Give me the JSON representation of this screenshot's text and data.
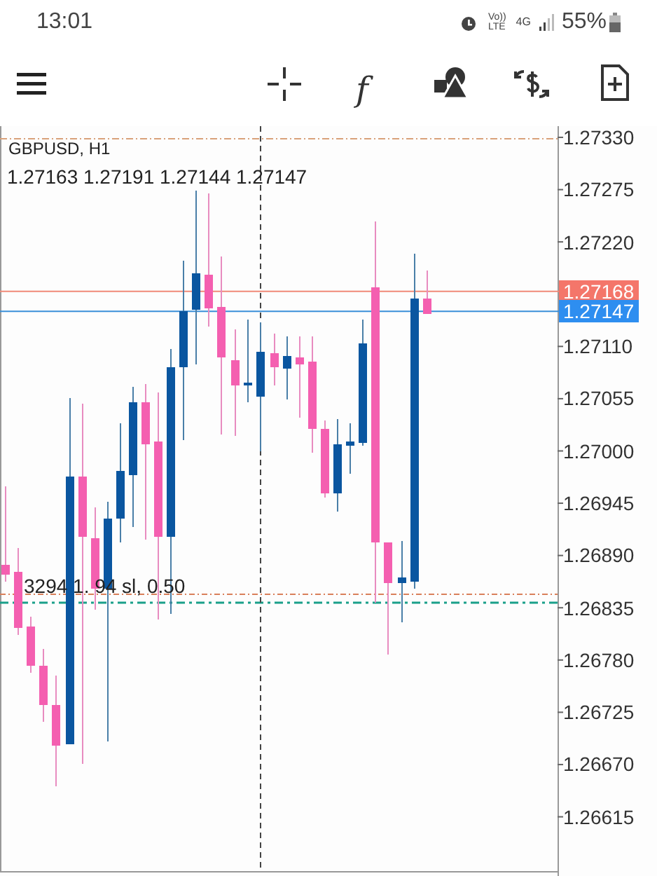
{
  "status_bar": {
    "time": "13:01",
    "volte_top": "Vo))",
    "volte_bottom": "LTE",
    "network": "4G",
    "battery": "55%"
  },
  "toolbar": {
    "function_glyph": "f"
  },
  "chart": {
    "symbol": "GBPUSD, H1",
    "ohlc": "1.27163 1.27191 1.27144 1.27147",
    "price_axis": [
      "1.27330",
      "1.27275",
      "1.27220",
      "1.27110",
      "1.27055",
      "1.27000",
      "1.26945",
      "1.26890",
      "1.26835",
      "1.26780",
      "1.26725",
      "1.26670",
      "1.26615"
    ],
    "bid_label": "1.27168",
    "ask_label": "1.27147",
    "order_label": "3294 1. 94 sl, 0.50"
  }
}
